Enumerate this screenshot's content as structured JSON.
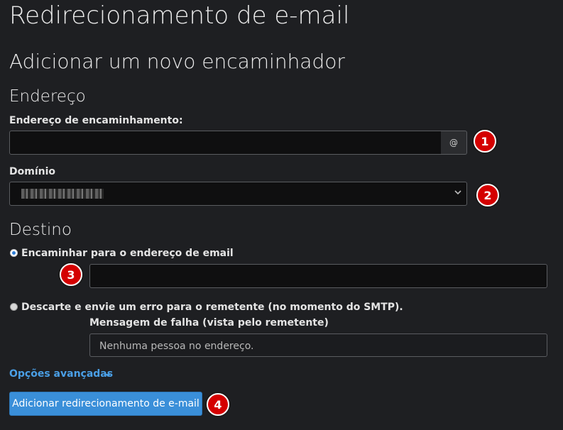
{
  "page": {
    "title": "Redirecionamento de e-mail",
    "subtitle": "Adicionar um novo encaminhador"
  },
  "address_section": {
    "heading": "Endereço",
    "forward_label": "Endereço de encaminhamento:",
    "forward_value": "",
    "at_symbol": "@",
    "domain_label": "Domínio",
    "domain_value": ""
  },
  "destination_section": {
    "heading": "Destino",
    "forward_option_label": "Encaminhar para o endereço de email",
    "forward_option_selected": true,
    "forward_target_value": "",
    "discard_option_label": "Descarte e envie um erro para o remetente (no momento do SMTP).",
    "discard_option_selected": false,
    "failure_message_label": "Mensagem de falha (vista pelo remetente)",
    "failure_message_value": "Nenhuma pessoa no endereço."
  },
  "advanced": {
    "link_label": "Opções avançadas"
  },
  "submit": {
    "label": "Adicionar redirecionamento de e-mail"
  },
  "badges": [
    "1",
    "2",
    "3",
    "4"
  ],
  "colors": {
    "background": "#1e1f22",
    "accent": "#3a8fd9",
    "link": "#4a9fe6",
    "badge": "#d40000"
  }
}
